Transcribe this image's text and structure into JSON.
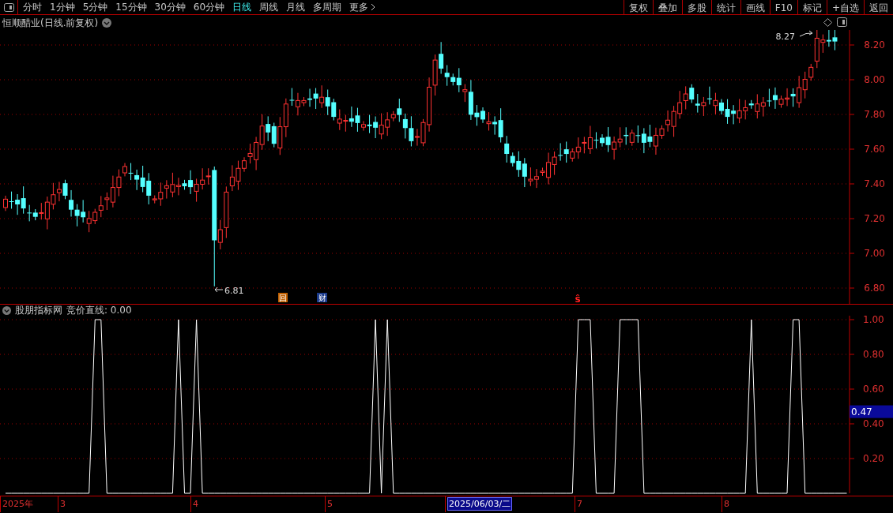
{
  "toolbar": {
    "periods": [
      {
        "label": "分时",
        "selected": false
      },
      {
        "label": "1分钟",
        "selected": false
      },
      {
        "label": "5分钟",
        "selected": false
      },
      {
        "label": "15分钟",
        "selected": false
      },
      {
        "label": "30分钟",
        "selected": false
      },
      {
        "label": "60分钟",
        "selected": false
      },
      {
        "label": "日线",
        "selected": true
      },
      {
        "label": "周线",
        "selected": false
      },
      {
        "label": "月线",
        "selected": false
      },
      {
        "label": "多周期",
        "selected": false
      },
      {
        "label": "更多",
        "selected": false
      }
    ],
    "buttons": [
      "复权",
      "叠加",
      "多股",
      "统计",
      "画线",
      "F10",
      "标记",
      "+自选",
      "返回"
    ]
  },
  "main_chart": {
    "title": "恒顺醋业(日线.前复权)",
    "price_axis": [
      "8.20",
      "8.00",
      "7.80",
      "7.60",
      "7.40",
      "7.20",
      "7.00",
      "6.80"
    ],
    "high_label": "8.27",
    "low_label": "6.81",
    "event_marks": [
      {
        "text": "回",
        "kind": "repurchase"
      },
      {
        "text": "财",
        "kind": "finance"
      },
      {
        "text": "ŝ",
        "kind": "s"
      }
    ]
  },
  "indicator": {
    "title": "股朋指标网",
    "reading": "竞价直线: 0.00",
    "cursor_value": "0.47",
    "chart_data": {
      "type": "line",
      "grid": true,
      "ylim": [
        0,
        1
      ],
      "yticks": [
        {
          "value": 0.2,
          "label": "0.20"
        },
        {
          "value": 0.4,
          "label": "0.40"
        },
        {
          "value": 0.6,
          "label": "0.60"
        },
        {
          "value": 0.8,
          "label": "0.80"
        },
        {
          "value": 1.0,
          "label": "1.00"
        }
      ],
      "series": [
        {
          "color": "#ffffff",
          "values": [
            0,
            0,
            0,
            0,
            0,
            0,
            0,
            0,
            0,
            0,
            0,
            0,
            0,
            0,
            0,
            1,
            1,
            0,
            0,
            0,
            0,
            0,
            0,
            0,
            0,
            0,
            0,
            0,
            0,
            1,
            0,
            0,
            1,
            0,
            0,
            0,
            0,
            0,
            0,
            0,
            0,
            0,
            0,
            0,
            0,
            0,
            0,
            0,
            0,
            0,
            0,
            0,
            0,
            0,
            0,
            0,
            0,
            0,
            0,
            0,
            0,
            0,
            1,
            0,
            1,
            0,
            0,
            0,
            0,
            0,
            0,
            0,
            0,
            0,
            0,
            0,
            0,
            0,
            0,
            0,
            0,
            0,
            0,
            0,
            0,
            0,
            0,
            0,
            0,
            0,
            0,
            0,
            0,
            0,
            0,
            0,
            1,
            1,
            1,
            0,
            0,
            0,
            0,
            1,
            1,
            1,
            1,
            0,
            0,
            0,
            0,
            0,
            0,
            0,
            0,
            0,
            0,
            0,
            0,
            0,
            0,
            0,
            0,
            0,
            0,
            1,
            0,
            0,
            0,
            0,
            0,
            0,
            1,
            1,
            0,
            0,
            0,
            0,
            0,
            0,
            0,
            0
          ]
        }
      ]
    }
  },
  "date_axis": [
    {
      "label": "2025年",
      "selected": false
    },
    {
      "label": "3",
      "selected": false
    },
    {
      "label": "4",
      "selected": false
    },
    {
      "label": "5",
      "selected": false
    },
    {
      "label": "2025/06/03/二",
      "selected": true
    },
    {
      "label": "7",
      "selected": false
    },
    {
      "label": "8",
      "selected": false
    }
  ]
}
